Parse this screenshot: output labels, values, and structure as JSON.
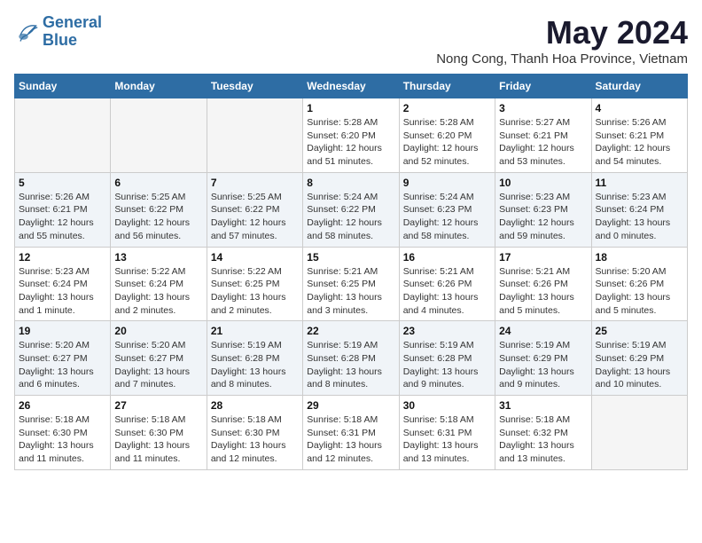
{
  "header": {
    "logo_line1": "General",
    "logo_line2": "Blue",
    "month_title": "May 2024",
    "location": "Nong Cong, Thanh Hoa Province, Vietnam"
  },
  "columns": [
    "Sunday",
    "Monday",
    "Tuesday",
    "Wednesday",
    "Thursday",
    "Friday",
    "Saturday"
  ],
  "weeks": [
    [
      {
        "day": "",
        "info": ""
      },
      {
        "day": "",
        "info": ""
      },
      {
        "day": "",
        "info": ""
      },
      {
        "day": "1",
        "info": "Sunrise: 5:28 AM\nSunset: 6:20 PM\nDaylight: 12 hours\nand 51 minutes."
      },
      {
        "day": "2",
        "info": "Sunrise: 5:28 AM\nSunset: 6:20 PM\nDaylight: 12 hours\nand 52 minutes."
      },
      {
        "day": "3",
        "info": "Sunrise: 5:27 AM\nSunset: 6:21 PM\nDaylight: 12 hours\nand 53 minutes."
      },
      {
        "day": "4",
        "info": "Sunrise: 5:26 AM\nSunset: 6:21 PM\nDaylight: 12 hours\nand 54 minutes."
      }
    ],
    [
      {
        "day": "5",
        "info": "Sunrise: 5:26 AM\nSunset: 6:21 PM\nDaylight: 12 hours\nand 55 minutes."
      },
      {
        "day": "6",
        "info": "Sunrise: 5:25 AM\nSunset: 6:22 PM\nDaylight: 12 hours\nand 56 minutes."
      },
      {
        "day": "7",
        "info": "Sunrise: 5:25 AM\nSunset: 6:22 PM\nDaylight: 12 hours\nand 57 minutes."
      },
      {
        "day": "8",
        "info": "Sunrise: 5:24 AM\nSunset: 6:22 PM\nDaylight: 12 hours\nand 58 minutes."
      },
      {
        "day": "9",
        "info": "Sunrise: 5:24 AM\nSunset: 6:23 PM\nDaylight: 12 hours\nand 58 minutes."
      },
      {
        "day": "10",
        "info": "Sunrise: 5:23 AM\nSunset: 6:23 PM\nDaylight: 12 hours\nand 59 minutes."
      },
      {
        "day": "11",
        "info": "Sunrise: 5:23 AM\nSunset: 6:24 PM\nDaylight: 13 hours\nand 0 minutes."
      }
    ],
    [
      {
        "day": "12",
        "info": "Sunrise: 5:23 AM\nSunset: 6:24 PM\nDaylight: 13 hours\nand 1 minute."
      },
      {
        "day": "13",
        "info": "Sunrise: 5:22 AM\nSunset: 6:24 PM\nDaylight: 13 hours\nand 2 minutes."
      },
      {
        "day": "14",
        "info": "Sunrise: 5:22 AM\nSunset: 6:25 PM\nDaylight: 13 hours\nand 2 minutes."
      },
      {
        "day": "15",
        "info": "Sunrise: 5:21 AM\nSunset: 6:25 PM\nDaylight: 13 hours\nand 3 minutes."
      },
      {
        "day": "16",
        "info": "Sunrise: 5:21 AM\nSunset: 6:26 PM\nDaylight: 13 hours\nand 4 minutes."
      },
      {
        "day": "17",
        "info": "Sunrise: 5:21 AM\nSunset: 6:26 PM\nDaylight: 13 hours\nand 5 minutes."
      },
      {
        "day": "18",
        "info": "Sunrise: 5:20 AM\nSunset: 6:26 PM\nDaylight: 13 hours\nand 5 minutes."
      }
    ],
    [
      {
        "day": "19",
        "info": "Sunrise: 5:20 AM\nSunset: 6:27 PM\nDaylight: 13 hours\nand 6 minutes."
      },
      {
        "day": "20",
        "info": "Sunrise: 5:20 AM\nSunset: 6:27 PM\nDaylight: 13 hours\nand 7 minutes."
      },
      {
        "day": "21",
        "info": "Sunrise: 5:19 AM\nSunset: 6:28 PM\nDaylight: 13 hours\nand 8 minutes."
      },
      {
        "day": "22",
        "info": "Sunrise: 5:19 AM\nSunset: 6:28 PM\nDaylight: 13 hours\nand 8 minutes."
      },
      {
        "day": "23",
        "info": "Sunrise: 5:19 AM\nSunset: 6:28 PM\nDaylight: 13 hours\nand 9 minutes."
      },
      {
        "day": "24",
        "info": "Sunrise: 5:19 AM\nSunset: 6:29 PM\nDaylight: 13 hours\nand 9 minutes."
      },
      {
        "day": "25",
        "info": "Sunrise: 5:19 AM\nSunset: 6:29 PM\nDaylight: 13 hours\nand 10 minutes."
      }
    ],
    [
      {
        "day": "26",
        "info": "Sunrise: 5:18 AM\nSunset: 6:30 PM\nDaylight: 13 hours\nand 11 minutes."
      },
      {
        "day": "27",
        "info": "Sunrise: 5:18 AM\nSunset: 6:30 PM\nDaylight: 13 hours\nand 11 minutes."
      },
      {
        "day": "28",
        "info": "Sunrise: 5:18 AM\nSunset: 6:30 PM\nDaylight: 13 hours\nand 12 minutes."
      },
      {
        "day": "29",
        "info": "Sunrise: 5:18 AM\nSunset: 6:31 PM\nDaylight: 13 hours\nand 12 minutes."
      },
      {
        "day": "30",
        "info": "Sunrise: 5:18 AM\nSunset: 6:31 PM\nDaylight: 13 hours\nand 13 minutes."
      },
      {
        "day": "31",
        "info": "Sunrise: 5:18 AM\nSunset: 6:32 PM\nDaylight: 13 hours\nand 13 minutes."
      },
      {
        "day": "",
        "info": ""
      }
    ]
  ]
}
